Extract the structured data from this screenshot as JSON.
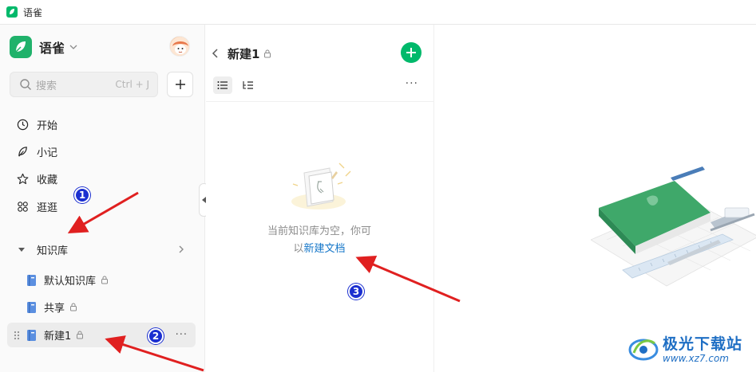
{
  "window": {
    "title": "语雀"
  },
  "sidebar": {
    "brand_name": "语雀",
    "search_placeholder": "搜索",
    "search_shortcut": "Ctrl + J",
    "nav_items": [
      {
        "label": "开始",
        "icon": "clock-icon"
      },
      {
        "label": "小记",
        "icon": "feather-icon"
      },
      {
        "label": "收藏",
        "icon": "star-icon"
      },
      {
        "label": "逛逛",
        "icon": "grid-icon"
      }
    ],
    "knowledge_base_label": "知识库",
    "libraries": [
      {
        "label": "默认知识库",
        "locked": true
      },
      {
        "label": "共享",
        "locked": true
      },
      {
        "label": "新建1",
        "locked": true,
        "active": true
      }
    ],
    "more_label": "···"
  },
  "panel": {
    "title": "新建1",
    "more_label": "···",
    "empty_line1": "当前知识库为空，你可",
    "empty_prefix": "以",
    "empty_link": "新建文档"
  },
  "annotations": [
    "1",
    "2",
    "3"
  ],
  "watermark": {
    "name": "极光下载站",
    "url": "www.xz7.com"
  },
  "colors": {
    "brand_green": "#00b96b",
    "link_blue": "#1677c9",
    "annotation_red": "#e02020",
    "badge_blue": "#1b2fd0"
  }
}
